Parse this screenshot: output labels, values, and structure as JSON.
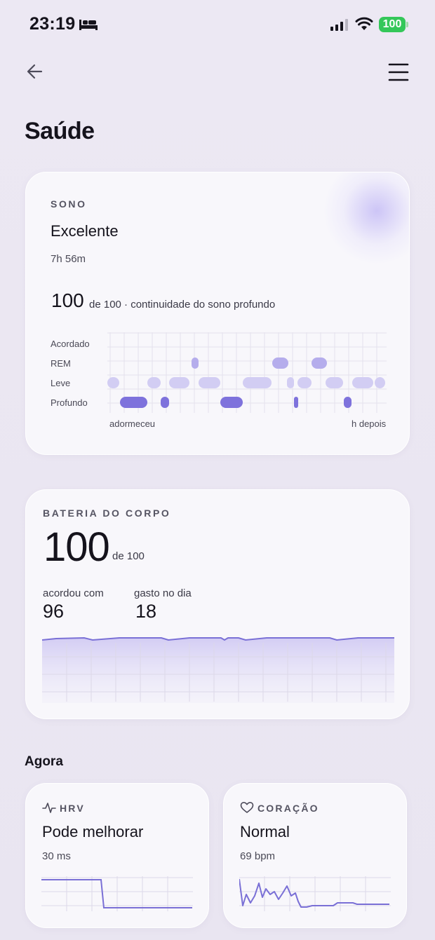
{
  "status_bar": {
    "time": "23:19",
    "battery": "100"
  },
  "page": {
    "title": "Saúde"
  },
  "sleep": {
    "label": "SONO",
    "status": "Excelente",
    "duration": "7h 56m",
    "score": "100",
    "score_suffix": "de 100 · continuidade do sono profundo",
    "stages": [
      "Acordado",
      "REM",
      "Leve",
      "Profundo"
    ],
    "axis_start": "adormeceu",
    "axis_end": "h depois"
  },
  "body_battery": {
    "label": "BATERIA DO CORPO",
    "value": "100",
    "suffix": "de 100",
    "woke_label": "acordou com",
    "woke_value": "96",
    "spent_label": "gasto no dia",
    "spent_value": "18"
  },
  "now": {
    "heading": "Agora",
    "hrv": {
      "title": "HRV",
      "status": "Pode melhorar",
      "value": "30 ms"
    },
    "heart": {
      "title": "CORAÇÃO",
      "status": "Normal",
      "value": "69 bpm"
    }
  },
  "colors": {
    "accent": "#7e72dc",
    "light_accent": "#c8c1ef",
    "line": "#7a70d6"
  }
}
